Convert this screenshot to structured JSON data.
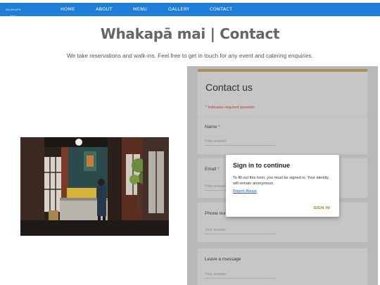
{
  "nav": {
    "logo_text": "WHAKAPA MAI",
    "links": [
      "HOME",
      "ABOUT",
      "MENU",
      "GALLERY",
      "CONTACT"
    ]
  },
  "page": {
    "title": "Whakapā mai | Contact",
    "subtitle": "We take reservations and walk-ins. Feel free to get in touch for any event and catering enquiries."
  },
  "photo": {
    "icon": "cafe-interior-photo"
  },
  "form": {
    "title": "Contact us",
    "required_note": "* Indicates required question",
    "questions": [
      {
        "label": "Name",
        "required": "*",
        "placeholder": "Your answer"
      },
      {
        "label": "Email",
        "required": "*",
        "placeholder": "Your answer"
      },
      {
        "label": "Phone number",
        "required": "",
        "placeholder": "Your answer"
      },
      {
        "label": "Leave a message",
        "required": "",
        "placeholder": "Your answer"
      }
    ]
  },
  "dialog": {
    "title": "Sign in to continue",
    "body": "To fill out this form, you must be signed in. Your identity will remain anonymous.",
    "link": "Report Abuse",
    "button": "SIGN IN"
  },
  "colors": {
    "nav_bg": "#1f7ed6",
    "form_accent": "#a8925a",
    "sign_in": "#a97c1c",
    "link": "#1a56c8"
  }
}
